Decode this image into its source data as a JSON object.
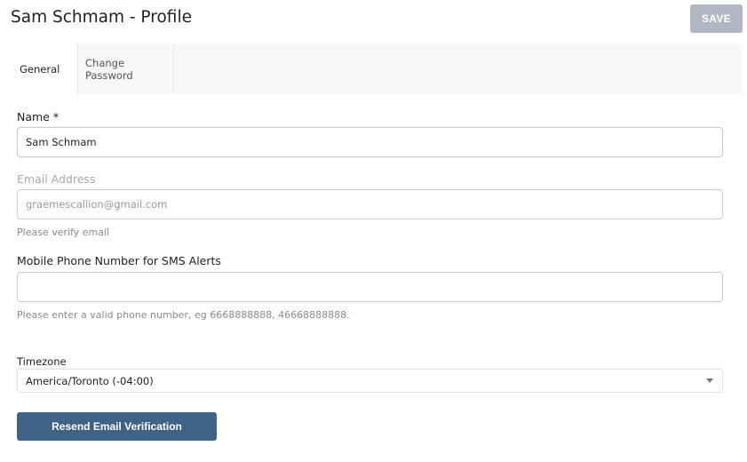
{
  "header": {
    "title": "Sam Schmam - Profile",
    "save_label": "SAVE"
  },
  "tabs": [
    {
      "label": "General",
      "active": true
    },
    {
      "label": "Change Password",
      "active": false
    }
  ],
  "form": {
    "name": {
      "label": "Name *",
      "value": "Sam Schmam"
    },
    "email": {
      "label": "Email Address",
      "value": "graemescallion@gmail.com",
      "hint": "Please verify email",
      "disabled": true
    },
    "phone": {
      "label": "Mobile Phone Number for SMS Alerts",
      "value": "",
      "hint": "Please enter a valid phone number, eg 6668888888, 46668888888."
    },
    "timezone": {
      "label": "Timezone",
      "selected": "America/Toronto (-04:00)",
      "icon": "chevron-down-icon"
    }
  },
  "actions": {
    "resend_label": "Resend Email Verification"
  },
  "colors": {
    "save_disabled": "#b0b7c2",
    "primary_button": "#3f6386",
    "tab_bar": "#f7f8fa"
  }
}
